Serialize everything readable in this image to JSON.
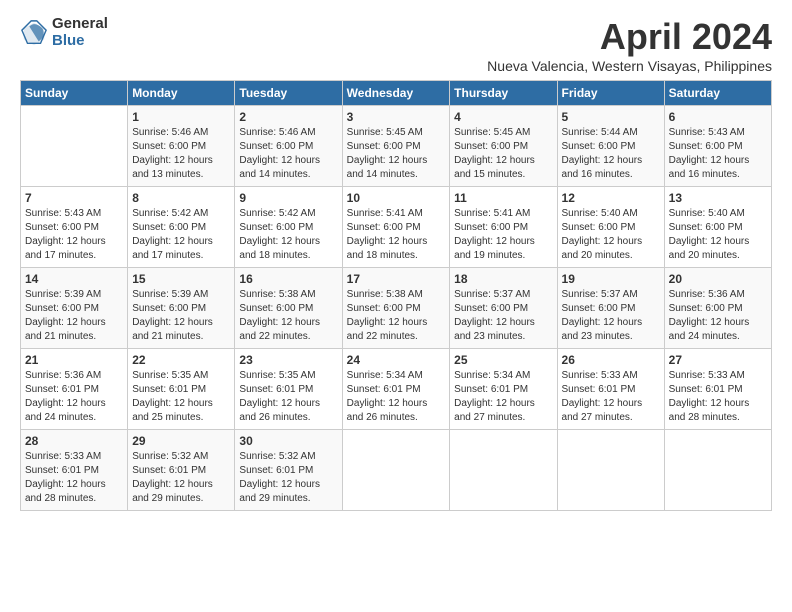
{
  "logo": {
    "general": "General",
    "blue": "Blue"
  },
  "header": {
    "title": "April 2024",
    "subtitle": "Nueva Valencia, Western Visayas, Philippines"
  },
  "weekdays": [
    "Sunday",
    "Monday",
    "Tuesday",
    "Wednesday",
    "Thursday",
    "Friday",
    "Saturday"
  ],
  "weeks": [
    [
      {
        "day": null,
        "sunrise": null,
        "sunset": null,
        "daylight": null
      },
      {
        "day": "1",
        "sunrise": "Sunrise: 5:46 AM",
        "sunset": "Sunset: 6:00 PM",
        "daylight": "Daylight: 12 hours and 13 minutes."
      },
      {
        "day": "2",
        "sunrise": "Sunrise: 5:46 AM",
        "sunset": "Sunset: 6:00 PM",
        "daylight": "Daylight: 12 hours and 14 minutes."
      },
      {
        "day": "3",
        "sunrise": "Sunrise: 5:45 AM",
        "sunset": "Sunset: 6:00 PM",
        "daylight": "Daylight: 12 hours and 14 minutes."
      },
      {
        "day": "4",
        "sunrise": "Sunrise: 5:45 AM",
        "sunset": "Sunset: 6:00 PM",
        "daylight": "Daylight: 12 hours and 15 minutes."
      },
      {
        "day": "5",
        "sunrise": "Sunrise: 5:44 AM",
        "sunset": "Sunset: 6:00 PM",
        "daylight": "Daylight: 12 hours and 16 minutes."
      },
      {
        "day": "6",
        "sunrise": "Sunrise: 5:43 AM",
        "sunset": "Sunset: 6:00 PM",
        "daylight": "Daylight: 12 hours and 16 minutes."
      }
    ],
    [
      {
        "day": "7",
        "sunrise": "Sunrise: 5:43 AM",
        "sunset": "Sunset: 6:00 PM",
        "daylight": "Daylight: 12 hours and 17 minutes."
      },
      {
        "day": "8",
        "sunrise": "Sunrise: 5:42 AM",
        "sunset": "Sunset: 6:00 PM",
        "daylight": "Daylight: 12 hours and 17 minutes."
      },
      {
        "day": "9",
        "sunrise": "Sunrise: 5:42 AM",
        "sunset": "Sunset: 6:00 PM",
        "daylight": "Daylight: 12 hours and 18 minutes."
      },
      {
        "day": "10",
        "sunrise": "Sunrise: 5:41 AM",
        "sunset": "Sunset: 6:00 PM",
        "daylight": "Daylight: 12 hours and 18 minutes."
      },
      {
        "day": "11",
        "sunrise": "Sunrise: 5:41 AM",
        "sunset": "Sunset: 6:00 PM",
        "daylight": "Daylight: 12 hours and 19 minutes."
      },
      {
        "day": "12",
        "sunrise": "Sunrise: 5:40 AM",
        "sunset": "Sunset: 6:00 PM",
        "daylight": "Daylight: 12 hours and 20 minutes."
      },
      {
        "day": "13",
        "sunrise": "Sunrise: 5:40 AM",
        "sunset": "Sunset: 6:00 PM",
        "daylight": "Daylight: 12 hours and 20 minutes."
      }
    ],
    [
      {
        "day": "14",
        "sunrise": "Sunrise: 5:39 AM",
        "sunset": "Sunset: 6:00 PM",
        "daylight": "Daylight: 12 hours and 21 minutes."
      },
      {
        "day": "15",
        "sunrise": "Sunrise: 5:39 AM",
        "sunset": "Sunset: 6:00 PM",
        "daylight": "Daylight: 12 hours and 21 minutes."
      },
      {
        "day": "16",
        "sunrise": "Sunrise: 5:38 AM",
        "sunset": "Sunset: 6:00 PM",
        "daylight": "Daylight: 12 hours and 22 minutes."
      },
      {
        "day": "17",
        "sunrise": "Sunrise: 5:38 AM",
        "sunset": "Sunset: 6:00 PM",
        "daylight": "Daylight: 12 hours and 22 minutes."
      },
      {
        "day": "18",
        "sunrise": "Sunrise: 5:37 AM",
        "sunset": "Sunset: 6:00 PM",
        "daylight": "Daylight: 12 hours and 23 minutes."
      },
      {
        "day": "19",
        "sunrise": "Sunrise: 5:37 AM",
        "sunset": "Sunset: 6:00 PM",
        "daylight": "Daylight: 12 hours and 23 minutes."
      },
      {
        "day": "20",
        "sunrise": "Sunrise: 5:36 AM",
        "sunset": "Sunset: 6:00 PM",
        "daylight": "Daylight: 12 hours and 24 minutes."
      }
    ],
    [
      {
        "day": "21",
        "sunrise": "Sunrise: 5:36 AM",
        "sunset": "Sunset: 6:01 PM",
        "daylight": "Daylight: 12 hours and 24 minutes."
      },
      {
        "day": "22",
        "sunrise": "Sunrise: 5:35 AM",
        "sunset": "Sunset: 6:01 PM",
        "daylight": "Daylight: 12 hours and 25 minutes."
      },
      {
        "day": "23",
        "sunrise": "Sunrise: 5:35 AM",
        "sunset": "Sunset: 6:01 PM",
        "daylight": "Daylight: 12 hours and 26 minutes."
      },
      {
        "day": "24",
        "sunrise": "Sunrise: 5:34 AM",
        "sunset": "Sunset: 6:01 PM",
        "daylight": "Daylight: 12 hours and 26 minutes."
      },
      {
        "day": "25",
        "sunrise": "Sunrise: 5:34 AM",
        "sunset": "Sunset: 6:01 PM",
        "daylight": "Daylight: 12 hours and 27 minutes."
      },
      {
        "day": "26",
        "sunrise": "Sunrise: 5:33 AM",
        "sunset": "Sunset: 6:01 PM",
        "daylight": "Daylight: 12 hours and 27 minutes."
      },
      {
        "day": "27",
        "sunrise": "Sunrise: 5:33 AM",
        "sunset": "Sunset: 6:01 PM",
        "daylight": "Daylight: 12 hours and 28 minutes."
      }
    ],
    [
      {
        "day": "28",
        "sunrise": "Sunrise: 5:33 AM",
        "sunset": "Sunset: 6:01 PM",
        "daylight": "Daylight: 12 hours and 28 minutes."
      },
      {
        "day": "29",
        "sunrise": "Sunrise: 5:32 AM",
        "sunset": "Sunset: 6:01 PM",
        "daylight": "Daylight: 12 hours and 29 minutes."
      },
      {
        "day": "30",
        "sunrise": "Sunrise: 5:32 AM",
        "sunset": "Sunset: 6:01 PM",
        "daylight": "Daylight: 12 hours and 29 minutes."
      },
      {
        "day": null,
        "sunrise": null,
        "sunset": null,
        "daylight": null
      },
      {
        "day": null,
        "sunrise": null,
        "sunset": null,
        "daylight": null
      },
      {
        "day": null,
        "sunrise": null,
        "sunset": null,
        "daylight": null
      },
      {
        "day": null,
        "sunrise": null,
        "sunset": null,
        "daylight": null
      }
    ]
  ]
}
